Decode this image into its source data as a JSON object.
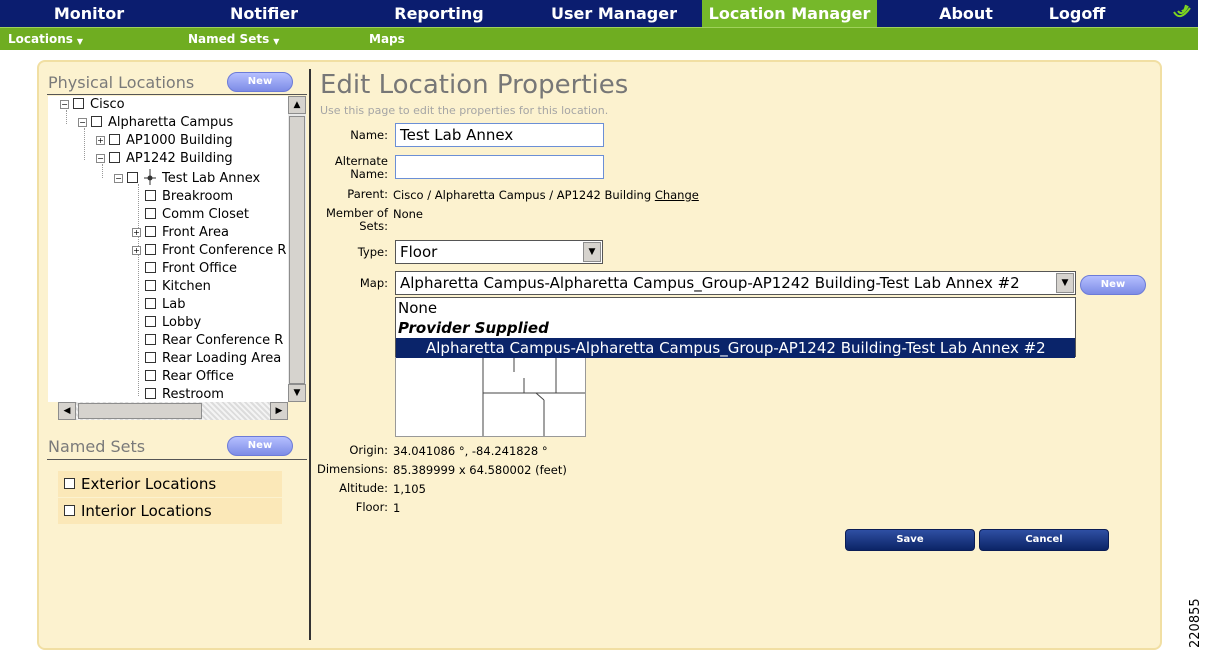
{
  "topnav": {
    "items": [
      {
        "label": "Monitor",
        "active": false
      },
      {
        "label": "Notifier",
        "active": false
      },
      {
        "label": "Reporting",
        "active": false
      },
      {
        "label": "User Manager",
        "active": false
      },
      {
        "label": "Location Manager",
        "active": true
      },
      {
        "label": "About",
        "active": false
      },
      {
        "label": "Logoff",
        "active": false
      }
    ],
    "logo_icon": "cisco-wave-icon"
  },
  "subnav": {
    "items": [
      {
        "label": "Locations",
        "has_menu": true
      },
      {
        "label": "Named Sets",
        "has_menu": true
      },
      {
        "label": "Maps",
        "has_menu": false
      }
    ],
    "caret": "▼"
  },
  "physical_locations": {
    "title": "Physical Locations",
    "new_label": "New",
    "tree": [
      {
        "label": "Cisco",
        "expander": "−"
      },
      {
        "label": "Alpharetta Campus",
        "expander": "−"
      },
      {
        "label": "AP1000 Building",
        "expander": "+"
      },
      {
        "label": "AP1242 Building",
        "expander": "−"
      },
      {
        "label": "Test Lab Annex",
        "expander": "−",
        "selected": true
      },
      {
        "label": "Breakroom",
        "expander": ""
      },
      {
        "label": "Comm Closet",
        "expander": ""
      },
      {
        "label": "Front Area",
        "expander": "+"
      },
      {
        "label": "Front Conference R",
        "expander": "+"
      },
      {
        "label": "Front Office",
        "expander": ""
      },
      {
        "label": "Kitchen",
        "expander": ""
      },
      {
        "label": "Lab",
        "expander": ""
      },
      {
        "label": "Lobby",
        "expander": ""
      },
      {
        "label": "Rear Conference R",
        "expander": ""
      },
      {
        "label": "Rear Loading Area",
        "expander": ""
      },
      {
        "label": "Rear Office",
        "expander": ""
      },
      {
        "label": "Restroom",
        "expander": ""
      }
    ]
  },
  "named_sets": {
    "title": "Named Sets",
    "new_label": "New",
    "items": [
      "Exterior Locations",
      "Interior Locations"
    ]
  },
  "form": {
    "title": "Edit Location Properties",
    "subtitle": "Use this page to edit the properties for this location.",
    "name_label": "Name:",
    "name_value": "Test Lab Annex",
    "alt_name_label_1": "Alternate",
    "alt_name_label_2": "Name:",
    "alt_name_value": "",
    "parent_label": "Parent:",
    "parent_value": "Cisco / Alpharetta Campus / AP1242 Building",
    "change_label": "Change",
    "member_label_1": "Member of",
    "member_label_2": "Sets:",
    "member_value": "None",
    "type_label": "Type:",
    "type_value": "Floor",
    "map_label": "Map:",
    "map_value": "Alpharetta Campus-Alpharetta Campus_Group-AP1242 Building-Test Lab Annex #2",
    "map_new_label": "New",
    "map_options": [
      "None",
      "Provider Supplied",
      "Alpharetta Campus-Alpharetta Campus_Group-AP1242 Building-Test Lab Annex #2"
    ],
    "origin_label": "Origin:",
    "origin_value": "34.041086 °, -84.241828 °",
    "dimensions_label": "Dimensions:",
    "dimensions_value": "85.389999 x 64.580002 (feet)",
    "altitude_label": "Altitude:",
    "altitude_value": "1,105",
    "floor_label": "Floor:",
    "floor_value": "1",
    "save_label": "Save",
    "cancel_label": "Cancel"
  },
  "figure_id": "220855"
}
